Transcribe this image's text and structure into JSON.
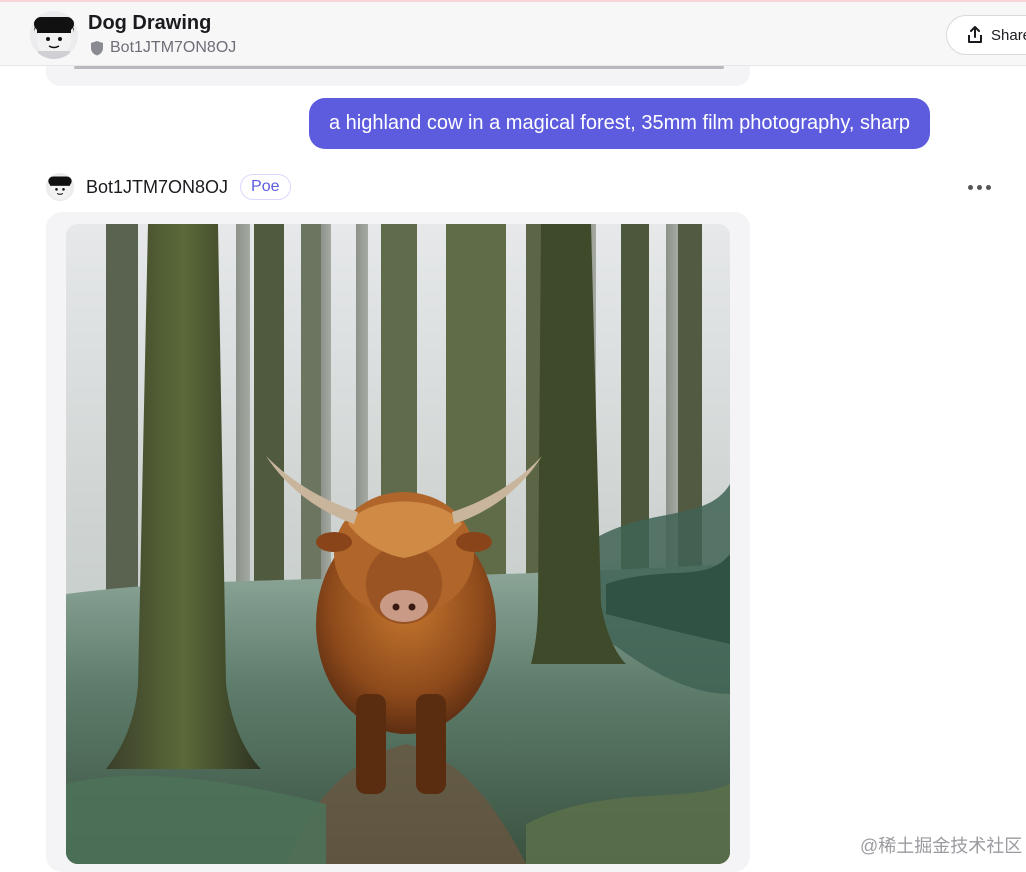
{
  "header": {
    "title": "Dog Drawing",
    "bot_handle": "Bot1JTM7ON8OJ",
    "share_label": "Share"
  },
  "conversation": {
    "user_message": "a highland cow in a magical forest, 35mm film photography, sharp",
    "bot_reply": {
      "bot_name": "Bot1JTM7ON8OJ",
      "badge": "Poe",
      "image_subject": "highland cow standing in a misty pine forest"
    }
  },
  "watermark": "@稀土掘金技术社区",
  "colors": {
    "accent": "#5d5cde",
    "header_bg": "#f7f7f8",
    "card_bg": "#f4f4f6"
  },
  "icons": {
    "shield": "shield-icon",
    "share": "share-icon",
    "more": "more-horizontal-icon"
  }
}
